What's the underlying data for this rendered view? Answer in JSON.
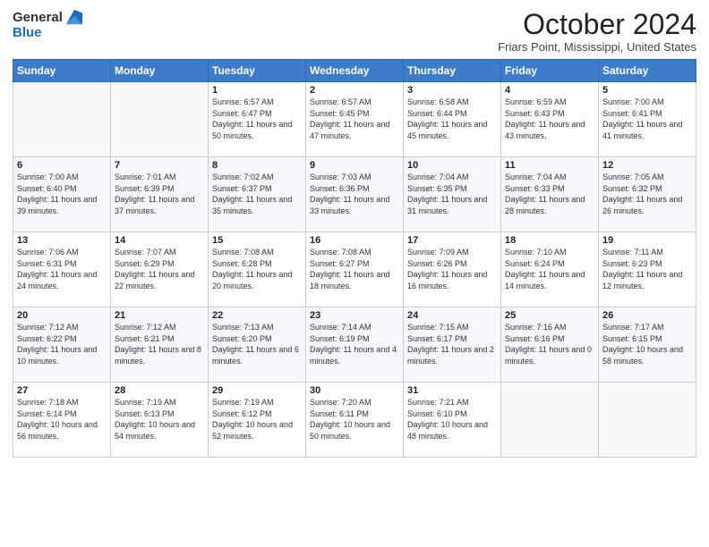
{
  "header": {
    "logo_general": "General",
    "logo_blue": "Blue",
    "title": "October 2024",
    "location": "Friars Point, Mississippi, United States"
  },
  "days_of_week": [
    "Sunday",
    "Monday",
    "Tuesday",
    "Wednesday",
    "Thursday",
    "Friday",
    "Saturday"
  ],
  "weeks": [
    [
      {
        "day": "",
        "info": ""
      },
      {
        "day": "",
        "info": ""
      },
      {
        "day": "1",
        "info": "Sunrise: 6:57 AM\nSunset: 6:47 PM\nDaylight: 11 hours and 50 minutes."
      },
      {
        "day": "2",
        "info": "Sunrise: 6:57 AM\nSunset: 6:45 PM\nDaylight: 11 hours and 47 minutes."
      },
      {
        "day": "3",
        "info": "Sunrise: 6:58 AM\nSunset: 6:44 PM\nDaylight: 11 hours and 45 minutes."
      },
      {
        "day": "4",
        "info": "Sunrise: 6:59 AM\nSunset: 6:43 PM\nDaylight: 11 hours and 43 minutes."
      },
      {
        "day": "5",
        "info": "Sunrise: 7:00 AM\nSunset: 6:41 PM\nDaylight: 11 hours and 41 minutes."
      }
    ],
    [
      {
        "day": "6",
        "info": "Sunrise: 7:00 AM\nSunset: 6:40 PM\nDaylight: 11 hours and 39 minutes."
      },
      {
        "day": "7",
        "info": "Sunrise: 7:01 AM\nSunset: 6:39 PM\nDaylight: 11 hours and 37 minutes."
      },
      {
        "day": "8",
        "info": "Sunrise: 7:02 AM\nSunset: 6:37 PM\nDaylight: 11 hours and 35 minutes."
      },
      {
        "day": "9",
        "info": "Sunrise: 7:03 AM\nSunset: 6:36 PM\nDaylight: 11 hours and 33 minutes."
      },
      {
        "day": "10",
        "info": "Sunrise: 7:04 AM\nSunset: 6:35 PM\nDaylight: 11 hours and 31 minutes."
      },
      {
        "day": "11",
        "info": "Sunrise: 7:04 AM\nSunset: 6:33 PM\nDaylight: 11 hours and 28 minutes."
      },
      {
        "day": "12",
        "info": "Sunrise: 7:05 AM\nSunset: 6:32 PM\nDaylight: 11 hours and 26 minutes."
      }
    ],
    [
      {
        "day": "13",
        "info": "Sunrise: 7:06 AM\nSunset: 6:31 PM\nDaylight: 11 hours and 24 minutes."
      },
      {
        "day": "14",
        "info": "Sunrise: 7:07 AM\nSunset: 6:29 PM\nDaylight: 11 hours and 22 minutes."
      },
      {
        "day": "15",
        "info": "Sunrise: 7:08 AM\nSunset: 6:28 PM\nDaylight: 11 hours and 20 minutes."
      },
      {
        "day": "16",
        "info": "Sunrise: 7:08 AM\nSunset: 6:27 PM\nDaylight: 11 hours and 18 minutes."
      },
      {
        "day": "17",
        "info": "Sunrise: 7:09 AM\nSunset: 6:26 PM\nDaylight: 11 hours and 16 minutes."
      },
      {
        "day": "18",
        "info": "Sunrise: 7:10 AM\nSunset: 6:24 PM\nDaylight: 11 hours and 14 minutes."
      },
      {
        "day": "19",
        "info": "Sunrise: 7:11 AM\nSunset: 6:23 PM\nDaylight: 11 hours and 12 minutes."
      }
    ],
    [
      {
        "day": "20",
        "info": "Sunrise: 7:12 AM\nSunset: 6:22 PM\nDaylight: 11 hours and 10 minutes."
      },
      {
        "day": "21",
        "info": "Sunrise: 7:12 AM\nSunset: 6:21 PM\nDaylight: 11 hours and 8 minutes."
      },
      {
        "day": "22",
        "info": "Sunrise: 7:13 AM\nSunset: 6:20 PM\nDaylight: 11 hours and 6 minutes."
      },
      {
        "day": "23",
        "info": "Sunrise: 7:14 AM\nSunset: 6:19 PM\nDaylight: 11 hours and 4 minutes."
      },
      {
        "day": "24",
        "info": "Sunrise: 7:15 AM\nSunset: 6:17 PM\nDaylight: 11 hours and 2 minutes."
      },
      {
        "day": "25",
        "info": "Sunrise: 7:16 AM\nSunset: 6:16 PM\nDaylight: 11 hours and 0 minutes."
      },
      {
        "day": "26",
        "info": "Sunrise: 7:17 AM\nSunset: 6:15 PM\nDaylight: 10 hours and 58 minutes."
      }
    ],
    [
      {
        "day": "27",
        "info": "Sunrise: 7:18 AM\nSunset: 6:14 PM\nDaylight: 10 hours and 56 minutes."
      },
      {
        "day": "28",
        "info": "Sunrise: 7:19 AM\nSunset: 6:13 PM\nDaylight: 10 hours and 54 minutes."
      },
      {
        "day": "29",
        "info": "Sunrise: 7:19 AM\nSunset: 6:12 PM\nDaylight: 10 hours and 52 minutes."
      },
      {
        "day": "30",
        "info": "Sunrise: 7:20 AM\nSunset: 6:11 PM\nDaylight: 10 hours and 50 minutes."
      },
      {
        "day": "31",
        "info": "Sunrise: 7:21 AM\nSunset: 6:10 PM\nDaylight: 10 hours and 48 minutes."
      },
      {
        "day": "",
        "info": ""
      },
      {
        "day": "",
        "info": ""
      }
    ]
  ]
}
